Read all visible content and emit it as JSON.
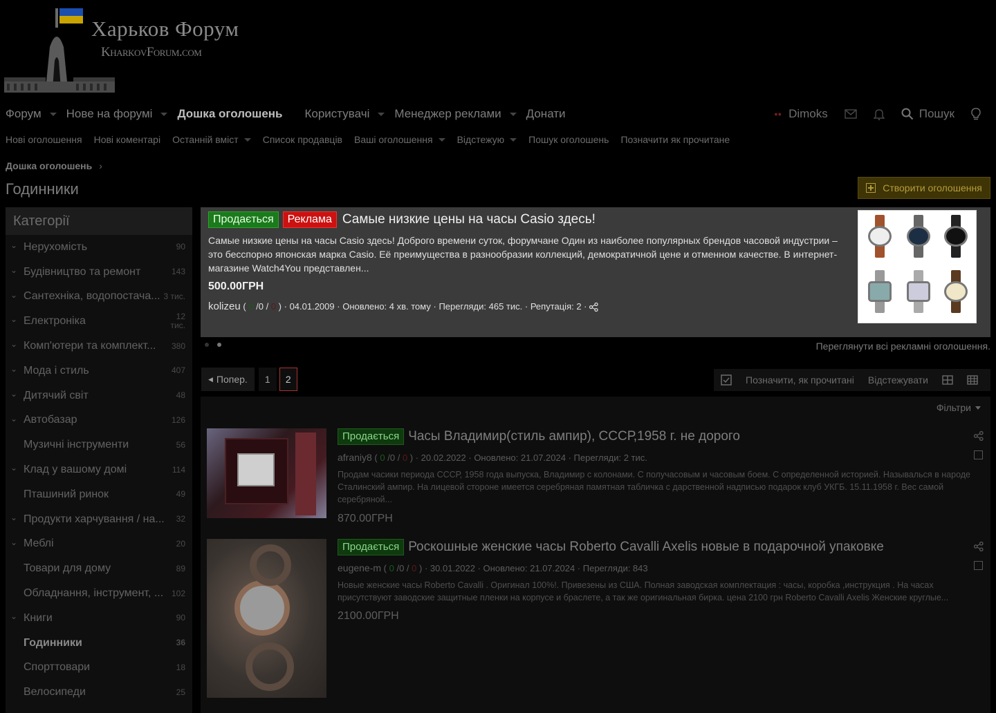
{
  "logo": {
    "title": "Харьков Форум",
    "subtitle": "KharkovForum.com"
  },
  "nav": {
    "items": [
      {
        "label": "Форум",
        "caret": true
      },
      {
        "label": "Нове на форумі",
        "caret": true
      },
      {
        "label": "Дошка оголошень",
        "active": true
      },
      {
        "label": "Користувачі",
        "caret": true
      },
      {
        "label": "Менеджер реклами",
        "caret": true
      },
      {
        "label": "Донати"
      }
    ],
    "user": "Dimoks",
    "search": "Пошук"
  },
  "subnav": {
    "items": [
      {
        "label": "Нові оголошення"
      },
      {
        "label": "Нові коментарі"
      },
      {
        "label": "Останній вміст",
        "caret": true
      },
      {
        "label": "Список продавців"
      },
      {
        "label": "Ваші оголошення",
        "caret": true
      },
      {
        "label": "Відстежую",
        "caret": true
      },
      {
        "label": "Пошук оголошень"
      },
      {
        "label": "Позначити як прочитане"
      }
    ]
  },
  "breadcrumb": "Дошка оголошень",
  "page_title": "Годинники",
  "create_button": "Створити оголошення",
  "sidebar": {
    "title": "Категорії",
    "categories": [
      {
        "label": "Нерухомість",
        "count": "90",
        "expand": true
      },
      {
        "label": "Будівництво та ремонт",
        "count": "143",
        "expand": true
      },
      {
        "label": "Сантехніка, водопостача...",
        "count": "3 тис.",
        "expand": true
      },
      {
        "label": "Електроніка",
        "count": "12 тис.",
        "expand": true
      },
      {
        "label": "Комп'ютери та комплект...",
        "count": "380",
        "expand": true
      },
      {
        "label": "Мода і стиль",
        "count": "407",
        "expand": true
      },
      {
        "label": "Дитячий світ",
        "count": "48",
        "expand": true
      },
      {
        "label": "Автобазар",
        "count": "126",
        "expand": true
      },
      {
        "label": "Музичні інструменти",
        "count": "56",
        "expand": false
      },
      {
        "label": "Клад у вашому домі",
        "count": "114",
        "expand": true
      },
      {
        "label": "Пташиний ринок",
        "count": "49",
        "expand": false
      },
      {
        "label": "Продукти харчування / на...",
        "count": "32",
        "expand": true
      },
      {
        "label": "Меблі",
        "count": "20",
        "expand": true
      },
      {
        "label": "Товари для дому",
        "count": "89",
        "expand": false
      },
      {
        "label": "Обладнання, інструмент, ...",
        "count": "102",
        "expand": false
      },
      {
        "label": "Книги",
        "count": "90",
        "expand": true
      },
      {
        "label": "Годинники",
        "count": "36",
        "expand": false,
        "selected": true
      },
      {
        "label": "Спорттовари",
        "count": "18",
        "expand": false
      },
      {
        "label": "Велосипеди",
        "count": "25",
        "expand": false
      }
    ]
  },
  "featured": {
    "badge_sale": "Продається",
    "badge_ad": "Реклама",
    "title": "Самые низкие цены на часы Casio здесь!",
    "description": "Самые низкие цены на часы Casio здесь! Доброго времени суток, форумчане Один из наиболее популярных брендов часовой индустрии – это бесспорно японская марка Casio. Её преимущества в разнообразии коллекций, демократичной цене и отменном качестве. В интернет-магазине Watch4You представлен...",
    "price": "500.00ГРН",
    "author": "kolizeu",
    "rep_pos": "0",
    "rep_mid": "/0 /",
    "rep_neg": "0",
    "date": "04.01.2009",
    "updated": "Оновлено: 4 хв. тому",
    "views": "Перегляди: 465 тис.",
    "reputation": "Репутація: 2",
    "view_all": "Переглянути всі рекламні оголошення."
  },
  "pager": {
    "prev": "Попер.",
    "pages": [
      "1",
      "2"
    ],
    "current": "2"
  },
  "toolbar": {
    "mark_read": "Позначити, як прочитані",
    "watch": "Відстежувати"
  },
  "filters": "Фільтри",
  "listings": [
    {
      "badge": "Продається",
      "title": "Часы Владимир(стиль ампир), СССР,1958 г. не дорого",
      "author": "afraniy8",
      "rep_pos": "0",
      "rep_mid": "/0 /",
      "rep_neg": "0",
      "date": "20.02.2022",
      "updated": "Оновлено: 21.07.2024",
      "views": "Перегляди: 2 тис.",
      "description": "Продам часики периода СССР, 1958 года выпуска, Владимир с колонами. С получасовым и часовым боем. С определенной историей. Называлься в народе Сталинский ампир. На лицевой стороне имеется серебряная памятная табличка с дарственной надписью подарок клуб УКГБ. 15.11.1958 г. Вес самой серебряной...",
      "price": "870.00ГРН"
    },
    {
      "badge": "Продається",
      "title": "Роскошные женские часы Roberto Cavalli Axelis новые в подарочной упаковке",
      "author": "eugene-m",
      "rep_pos": "0",
      "rep_mid": "/0 /",
      "rep_neg": "0",
      "date": "30.01.2022",
      "updated": "Оновлено: 21.07.2024",
      "views": "Перегляди: 843",
      "description": "Новые женские часы Roberto Cavalli . Оригинал 100%!. Привезены из США. Полная заводская комплектация : часы, коробка ,инструкция . На часах присутствуют заводские защитные пленки на корпусе и браслете, а так же оригинальная бирка. цена 2100 грн Roberto Cavalli Axelis Женские круглые...",
      "price": "2100.00ГРН"
    }
  ],
  "colors": {
    "accent_sale": "#1b7a1b",
    "accent_ad": "#cc1111",
    "create_btn": "#3e3405"
  }
}
